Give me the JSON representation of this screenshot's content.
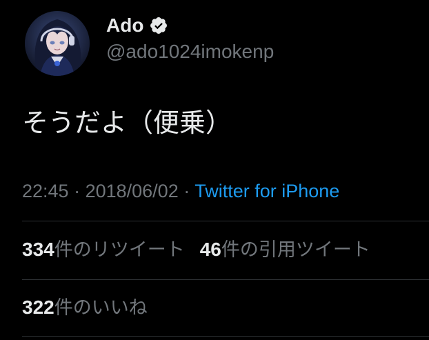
{
  "author": {
    "display_name": "Ado",
    "handle": "@ado1024imokenp",
    "verified": true,
    "avatar_icon": "avatar-anime-girl"
  },
  "tweet": {
    "text": "そうだよ（便乗）",
    "time": "22:45",
    "separator": " · ",
    "date": "2018/06/02",
    "source": "Twitter for iPhone"
  },
  "stats": {
    "retweets_count": "334",
    "retweets_label": "件のリツイート",
    "quotes_count": "46",
    "quotes_label": "件の引用ツイート",
    "likes_count": "322",
    "likes_label": "件のいいね"
  },
  "colors": {
    "background": "#000000",
    "primary_text": "#e7e9ea",
    "secondary_text": "#71767b",
    "link": "#1d9bf0",
    "divider": "#2f3336"
  }
}
